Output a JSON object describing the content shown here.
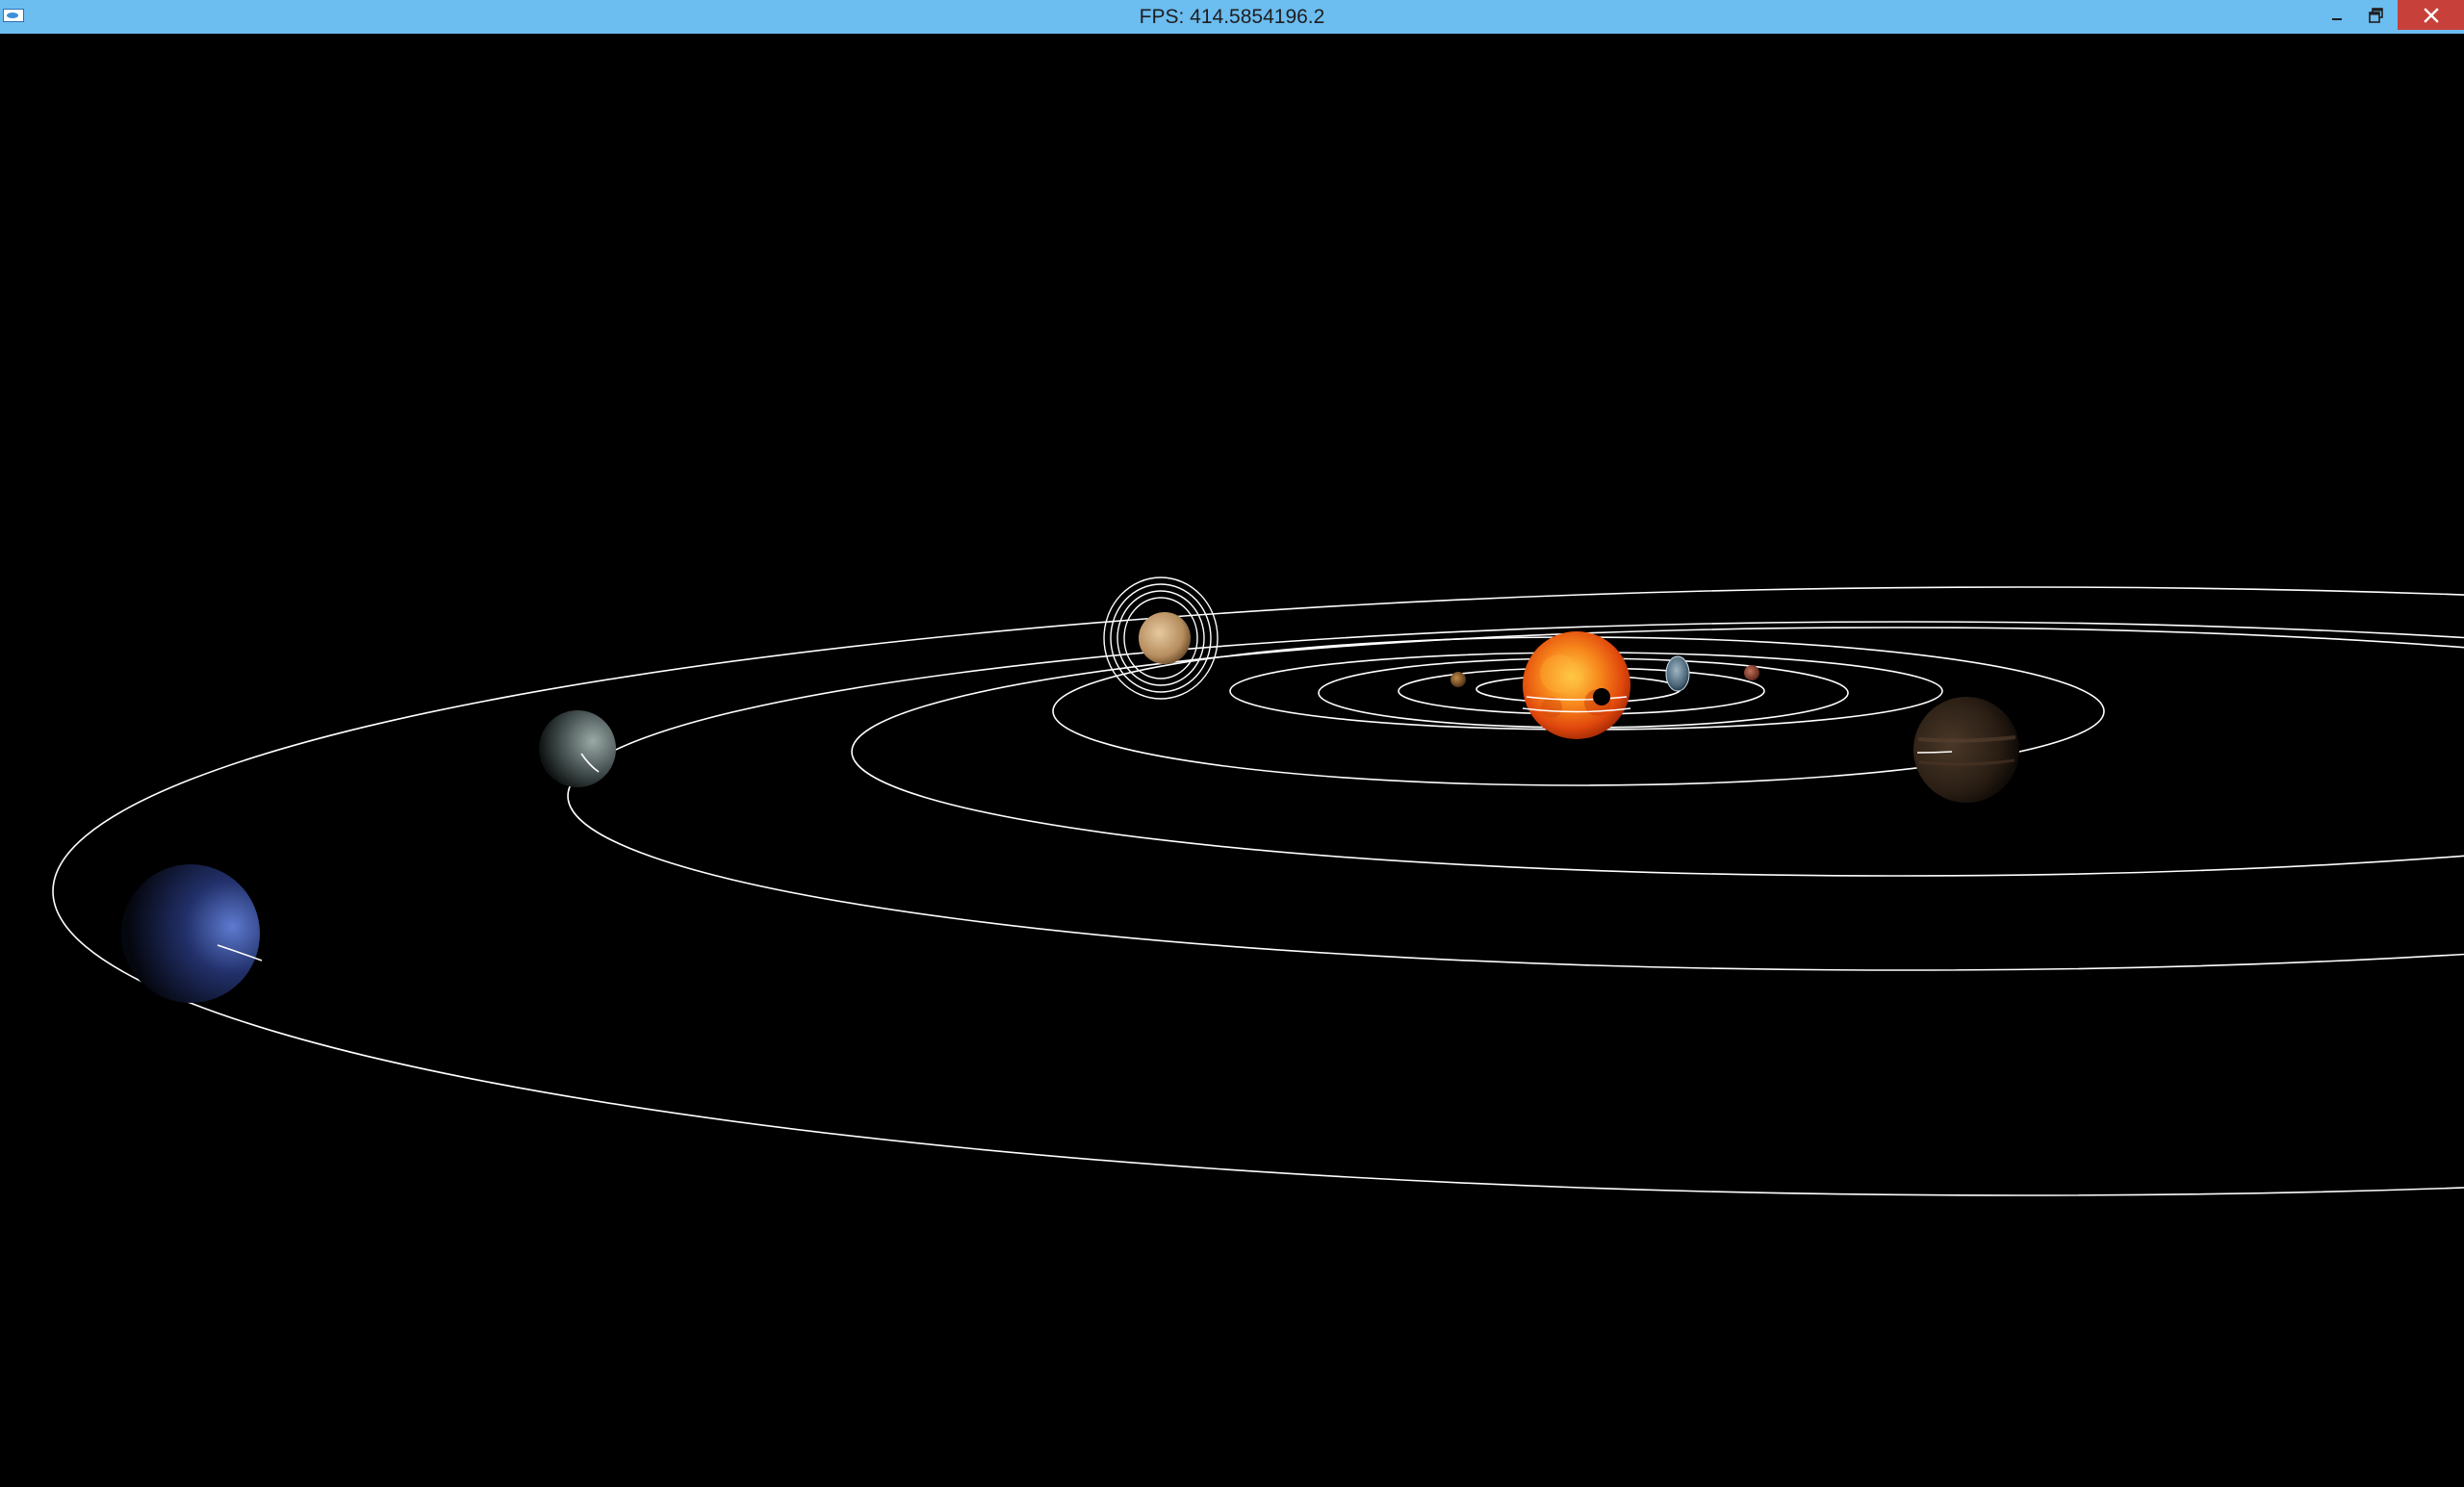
{
  "window": {
    "title": "FPS: 414.5854196.2",
    "titlebar_color": "#6cbdf0",
    "close_button_color": "#c7403a",
    "controls": {
      "minimize_icon": "minimize-icon",
      "maximize_icon": "restore-icon",
      "close_icon": "close-icon"
    }
  },
  "scene": {
    "background": "#000000",
    "orbit_color": "#ffffff",
    "bodies": [
      "sun",
      "mercury",
      "venus",
      "earth",
      "moon",
      "mars",
      "jupiter",
      "saturn",
      "uranus",
      "neptune"
    ],
    "colors": {
      "sun": "#e8550c",
      "mercury": "#8a5a33",
      "earth": "#4f6c82",
      "mars": "#8a3a2a",
      "jupiter": "#3d2d1f",
      "saturn": "#c6a27a",
      "uranus": "#5d6a6a",
      "neptune": "#3c4f95"
    }
  }
}
